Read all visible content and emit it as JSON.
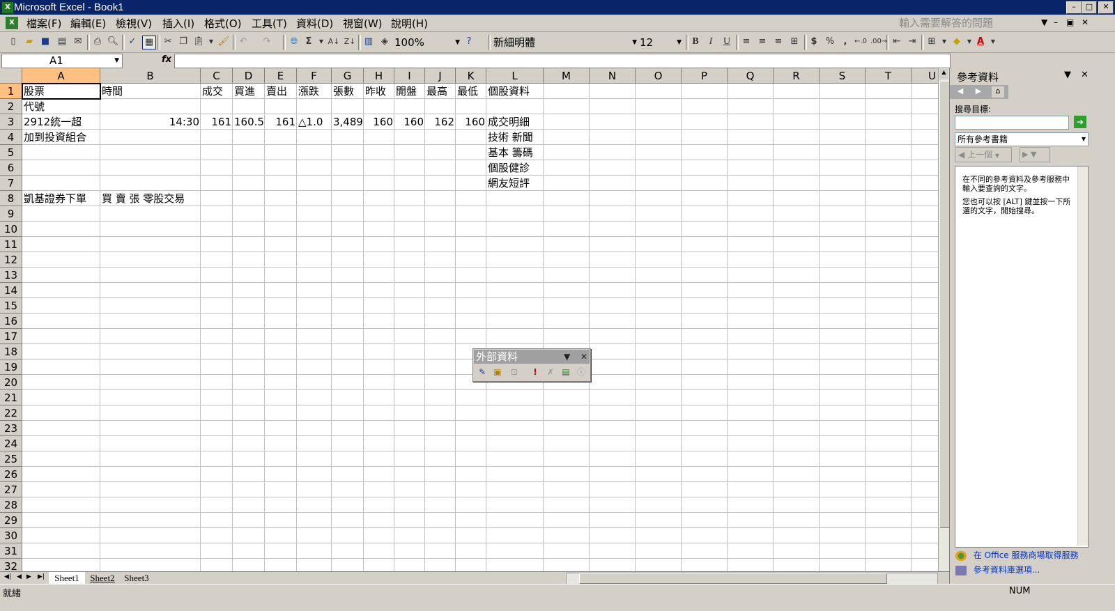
{
  "window": {
    "title": "Microsoft Excel - Book1",
    "min": "–",
    "max": "□",
    "close": "✕"
  },
  "menu": {
    "items": [
      "檔案(F)",
      "編輯(E)",
      "檢視(V)",
      "插入(I)",
      "格式(O)",
      "工具(T)",
      "資料(D)",
      "視窗(W)",
      "說明(H)"
    ],
    "help_placeholder": "輸入需要解答的問題"
  },
  "toolbar": {
    "zoom": "100%",
    "font": "新細明體",
    "size": "12",
    "bold": "B",
    "italic": "I",
    "underline": "U",
    "currency": "$",
    "percent": "%",
    "comma": ",",
    "autosum": "Σ"
  },
  "formula_bar": {
    "name_box": "A1",
    "fx": "fx",
    "value": ""
  },
  "grid": {
    "columns": [
      "A",
      "B",
      "C",
      "D",
      "E",
      "F",
      "G",
      "H",
      "I",
      "J",
      "K",
      "L",
      "M",
      "N",
      "O",
      "P",
      "Q",
      "R",
      "S",
      "T",
      "U"
    ],
    "rows": [
      "1",
      "2",
      "3",
      "4",
      "5",
      "6",
      "7",
      "8",
      "9",
      "10",
      "11",
      "12",
      "13",
      "14",
      "15",
      "16",
      "17",
      "18",
      "19",
      "20",
      "21",
      "22",
      "23",
      "24",
      "25",
      "26",
      "27",
      "28",
      "29",
      "30",
      "31",
      "32"
    ],
    "cells": {
      "A1": "股票",
      "B1": "時間",
      "C1": "成交",
      "D1": "買進",
      "E1": "賣出",
      "F1": "漲跌",
      "G1": "張數",
      "H1": "昨收",
      "I1": "開盤",
      "J1": "最高",
      "K1": "最低",
      "L1": "個股資料",
      "A2": "代號",
      "A3": "2912統一超",
      "B3": "14:30",
      "C3": "161",
      "D3": "160.5",
      "E3": "161",
      "F3": "△1.0",
      "G3": "3,489",
      "H3": "160",
      "I3": "160",
      "J3": "162",
      "K3": "160",
      "L3": "成交明細",
      "A4": "加到投資組合",
      "L4": "技術 新聞",
      "L5": "基本 籌碼",
      "L6": "個股健診",
      "L7": "網友短評",
      "A8": "凱基證券下單",
      "B8": "買 賣 張 零股交易"
    }
  },
  "external_toolbar": {
    "title": "外部資料"
  },
  "sheets": {
    "tabs": [
      "Sheet1",
      "Sheet2",
      "Sheet3"
    ],
    "active": "Sheet1"
  },
  "status": {
    "ready": "就緒",
    "num": "NUM"
  },
  "task_pane": {
    "title": "參考資料",
    "search_label": "搜尋目標:",
    "search_value": "",
    "scope": "所有參考書籍",
    "prev": "上一個",
    "help_1": "在不同的參考資料及參考服務中輸入要查詢的文字。",
    "help_2": "您也可以按 [ALT] 鍵並按一下所選的文字，開始搜尋。",
    "link_1": "在 Office 服務商場取得服務",
    "link_2": "參考資料庫選項..."
  },
  "colors": {
    "titlebar": "#0a246a",
    "chrome": "#d4d0c8",
    "selected_header": "#ffc080",
    "link": "#0033cc"
  }
}
